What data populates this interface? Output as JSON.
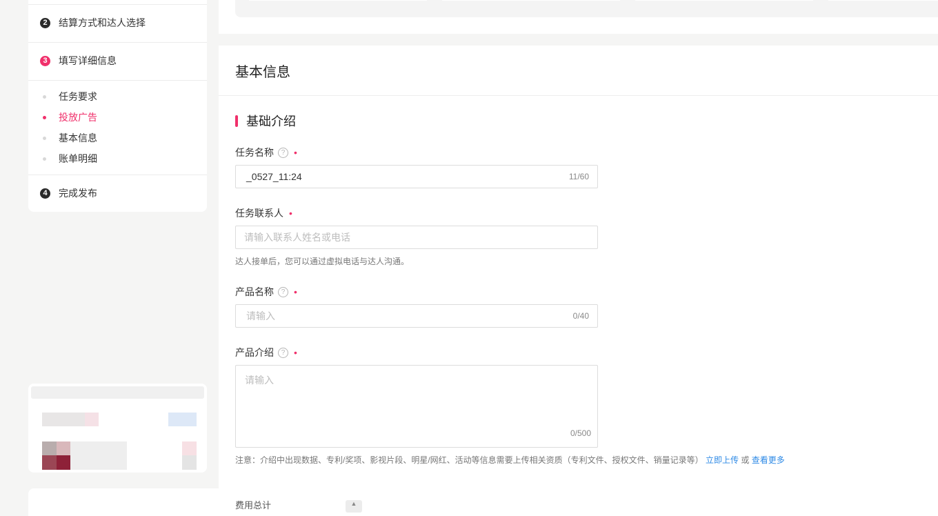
{
  "sidebar": {
    "steps": [
      {
        "num": "2",
        "label": "结算方式和达人选择"
      },
      {
        "num": "3",
        "label": "填写详细信息"
      },
      {
        "num": "4",
        "label": "完成发布"
      }
    ],
    "sub_items": [
      {
        "label": "任务要求"
      },
      {
        "label": "投放广告"
      },
      {
        "label": "基本信息"
      },
      {
        "label": "账单明细"
      }
    ]
  },
  "panel": {
    "title": "基本信息",
    "section_title": "基础介绍"
  },
  "form": {
    "task_name": {
      "label": "任务名称",
      "value": "_0527_11:24",
      "count": "11/60"
    },
    "contact": {
      "label": "任务联系人",
      "placeholder": "请输入联系人姓名或电话",
      "help": "达人接单后，您可以通过虚拟电话与达人沟通。"
    },
    "product_name": {
      "label": "产品名称",
      "placeholder": "请输入",
      "count": "0/40"
    },
    "product_intro": {
      "label": "产品介绍",
      "placeholder": "请输入",
      "count": "0/500"
    },
    "note_prefix": "注意：介绍中出现数据、专利/奖项、影视片段、明星/网红、活动等信息需要上传相关资质（专利文件、授权文件、销量记录等）",
    "upload_link": "立即上传",
    "or_text": "或",
    "more_link": "查看更多"
  },
  "footer": {
    "fee_label": "费用总计"
  },
  "icons": {
    "help": "question-circle-icon",
    "toggle": "chevron-up-icon"
  },
  "colors": {
    "accent": "#f0306b",
    "link": "#2e8ae6"
  }
}
